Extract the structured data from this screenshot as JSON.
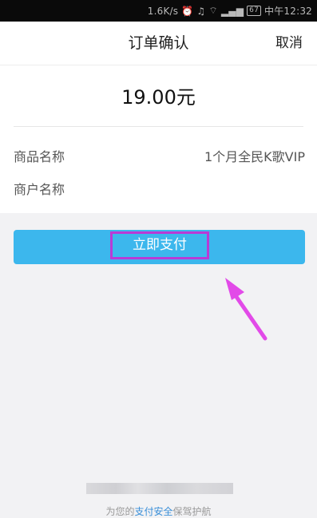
{
  "status_bar": {
    "speed": "1.6K/s",
    "icons": [
      "alarm-icon",
      "headset-icon",
      "wifi-icon",
      "signal-icon"
    ],
    "battery": "67",
    "time": "中午12:32"
  },
  "header": {
    "title": "订单确认",
    "cancel_label": "取消"
  },
  "order": {
    "amount": "19.00元"
  },
  "info": {
    "product_label": "商品名称",
    "product_value": "1个月全民K歌VIP",
    "merchant_label": "商户名称"
  },
  "pay_button": {
    "label": "立即支付"
  },
  "footer": {
    "prefix": "为您的",
    "link": "支付安全",
    "suffix": "保驾护航"
  },
  "colors": {
    "accent": "#3cb7ed",
    "highlight": "#b93ad6",
    "link": "#3a8fd8"
  }
}
